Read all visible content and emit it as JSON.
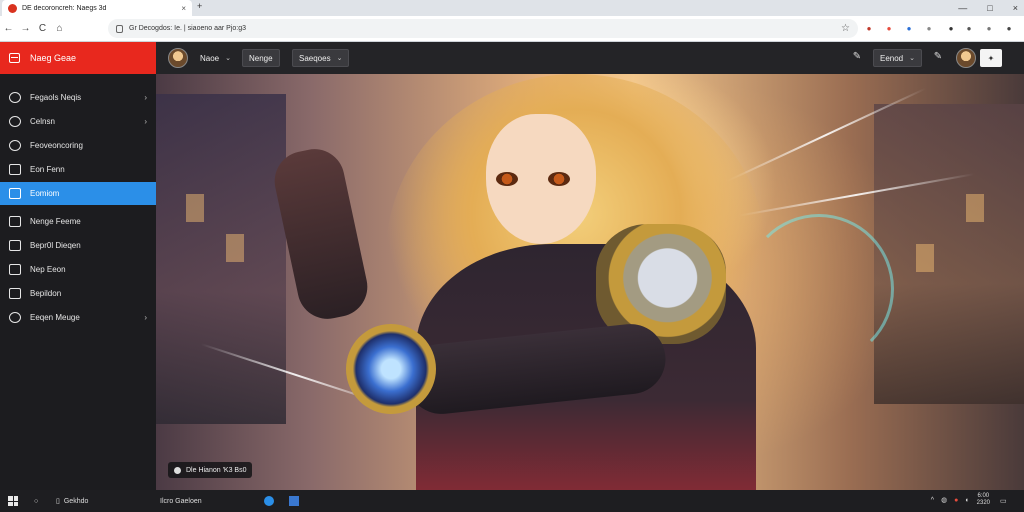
{
  "browser": {
    "tab_title": "DE decoroncreh: Naegs 3d",
    "tab_close": "×",
    "new_tab": "+",
    "window_controls": [
      "—",
      "□",
      "×"
    ],
    "nav": {
      "back": "←",
      "forward": "→",
      "reload": "C",
      "home": "⌂"
    },
    "address": "Gr Decogdos: Ie. | siaoeno aar Pjo:g3",
    "star": "☆",
    "extensions": [
      "●",
      "●",
      "●",
      "●",
      "●",
      "●",
      "●",
      "●"
    ]
  },
  "app": {
    "brand": "Naeg Geae",
    "header": {
      "user_label": "Naoe",
      "nav_button": "Nenge",
      "dropdown_label": "Saeqoes",
      "tools_icon": "✎",
      "right_dropdown": "Eenod",
      "edit_icon": "✎",
      "square_label": "✦"
    },
    "sidebar": {
      "items": [
        {
          "label": "Fegaols Neqis",
          "arrow": "›",
          "active": false,
          "icon": "round"
        },
        {
          "label": "Celnsn",
          "arrow": "›",
          "active": false,
          "icon": "round"
        },
        {
          "label": "Feoveoncoring",
          "arrow": "",
          "active": false,
          "icon": "round"
        },
        {
          "label": "Eon Fenn",
          "arrow": "",
          "active": false,
          "icon": "square"
        },
        {
          "label": "Eomiom",
          "arrow": "",
          "active": true,
          "icon": "square"
        },
        {
          "label": "Nenge Feeme",
          "arrow": "",
          "active": false,
          "icon": "square"
        },
        {
          "label": "Bepr0l Dieqen",
          "arrow": "",
          "active": false,
          "icon": "square"
        },
        {
          "label": "Nep Eeon",
          "arrow": "",
          "active": false,
          "icon": "square"
        },
        {
          "label": "Bepildon",
          "arrow": "",
          "active": false,
          "icon": "square"
        },
        {
          "label": "Eeqen Meuge",
          "arrow": "›",
          "active": false,
          "icon": "round"
        }
      ]
    },
    "hero": {
      "caption": "Dle Hianon 'K3 Bs0"
    }
  },
  "taskbar": {
    "search": "Gekhdo",
    "app_label": "Ilcro Gaeloen",
    "clock_time": "6:00",
    "clock_date": "2320"
  },
  "colors": {
    "brand_red": "#e8281e",
    "active_blue": "#2b8fe8",
    "dark_bg": "#1c1c1f"
  }
}
